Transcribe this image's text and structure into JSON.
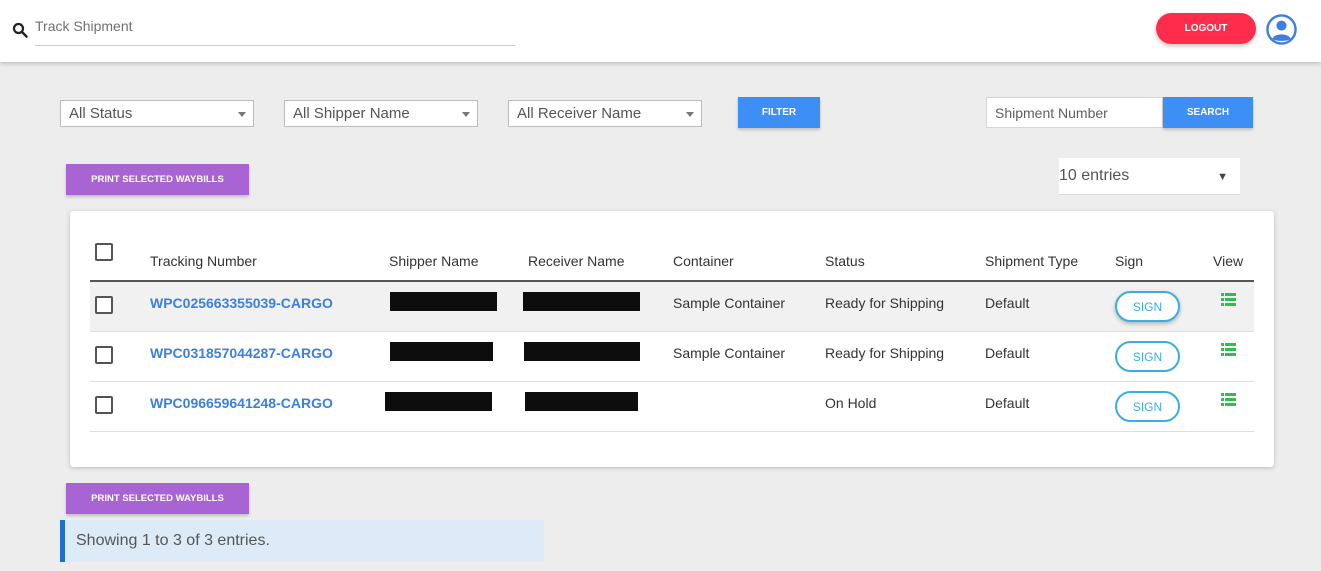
{
  "header": {
    "track_placeholder": "Track Shipment",
    "logout_label": "LOGOUT",
    "search_icon": "search-icon",
    "avatar_icon": "user-circle-icon",
    "logout_color": "#ff2d4b"
  },
  "filters": {
    "status": "All Status",
    "shipper": "All Shipper Name",
    "receiver": "All Receiver Name",
    "filter_label": "FILTER",
    "shipment_placeholder": "Shipment Number",
    "search_label": "SEARCH"
  },
  "actions": {
    "print_label": "PRINT SELECTED WAYBILLS",
    "entries": "10 entries",
    "entries_caret": "▼"
  },
  "table": {
    "headers": {
      "tracking": "Tracking Number",
      "shipper": "Shipper Name",
      "receiver": "Receiver Name",
      "container": "Container",
      "status": "Status",
      "type": "Shipment Type",
      "sign": "Sign",
      "view": "View"
    },
    "rows": [
      {
        "tracking": "WPC025663355039-CARGO",
        "container": "Sample Container",
        "status": "Ready for Shipping",
        "type": "Default",
        "sign": "SIGN"
      },
      {
        "tracking": "WPC031857044287-CARGO",
        "container": "Sample Container",
        "status": "Ready for Shipping",
        "type": "Default",
        "sign": "SIGN"
      },
      {
        "tracking": "WPC096659641248-CARGO",
        "container": "",
        "status": "On Hold",
        "type": "Default",
        "sign": "SIGN"
      }
    ]
  },
  "footer": {
    "info": "Showing 1 to 3 of 3 entries."
  },
  "colors": {
    "primary_blue": "#3d8ef5",
    "purple": "#a964d4",
    "link_blue": "#3d7fe0",
    "sign_teal": "#3aaee0",
    "view_green": "#2fbf4f"
  }
}
